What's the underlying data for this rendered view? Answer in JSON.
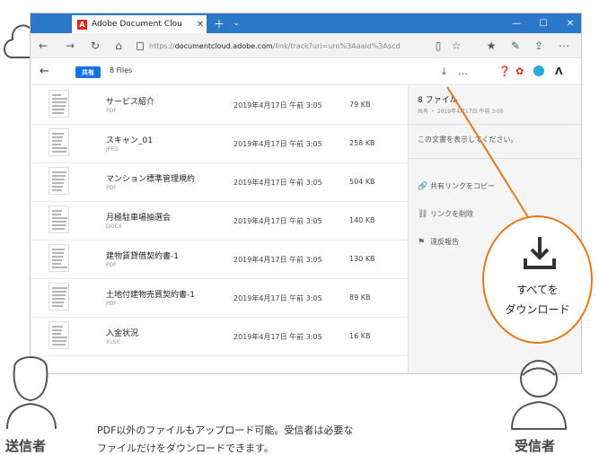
{
  "browser": {
    "tab_title": "Adobe Document Clou",
    "tab_icon": "adobe-icon",
    "url_prefix": "https://",
    "url_domain": "documentcloud.adobe.com",
    "url_path": "/link/track?uri=urn%3Aaaid%3Ascd",
    "accent": "#2b78c9"
  },
  "app_toolbar": {
    "shared_label": "共有",
    "file_count": "8 Files"
  },
  "files": [
    {
      "name": "サービス紹介",
      "type": "PDF",
      "date": "2019年4月17日 午前 3:05",
      "size": "79 KB"
    },
    {
      "name": "スキャン_01",
      "type": "JPEG",
      "date": "2019年4月17日 午前 3:05",
      "size": "258 KB"
    },
    {
      "name": "マンション標準管理規約",
      "type": "PDF",
      "date": "2019年4月17日 午前 3:05",
      "size": "504 KB"
    },
    {
      "name": "月極駐車場抽選会",
      "type": "DOCX",
      "date": "2019年4月17日 午前 3:05",
      "size": "140 KB"
    },
    {
      "name": "建物賃貸借契約書-1",
      "type": "PDF",
      "date": "2019年4月17日 午前 3:05",
      "size": "130 KB"
    },
    {
      "name": "土地付建物売買契約書-1",
      "type": "PDF",
      "date": "2019年4月17日 午前 3:05",
      "size": "89 KB"
    },
    {
      "name": "入金状況",
      "type": "XLSX",
      "date": "2019年4月17日 午前 3:05",
      "size": "16 KB"
    }
  ],
  "panel": {
    "title": "8 ファイル",
    "subtitle": "共有 ・ 2019年4月17日 午前 3:05",
    "message": "この文書を表示してください。",
    "actions": [
      {
        "label": "共有リンクをコピー",
        "icon": "link-icon"
      },
      {
        "label": "リンクを削除",
        "icon": "unlink-icon"
      },
      {
        "label": "違反報告",
        "icon": "flag-icon"
      }
    ]
  },
  "callout": {
    "line1": "すべてを",
    "line2": "ダウンロード",
    "color": "#e8771a"
  },
  "labels": {
    "sender": "送信者",
    "receiver": "受信者",
    "footnote_line1": "PDF以外のファイルもアップロード可能。受信者は必要な",
    "footnote_line2": "ファイルだけをダウンロードできます。"
  }
}
